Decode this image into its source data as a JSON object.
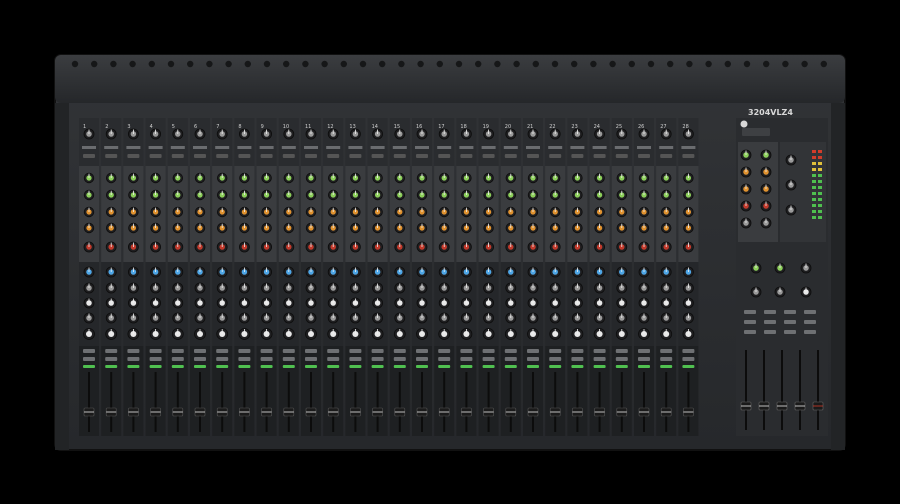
{
  "mixer": {
    "model_label": "3204VLZ4",
    "channels": [
      "1",
      "2",
      "3",
      "4",
      "5",
      "6",
      "7",
      "8",
      "9",
      "10",
      "11",
      "12",
      "13",
      "14",
      "15",
      "16",
      "17",
      "18",
      "19",
      "20",
      "21",
      "22",
      "23",
      "24",
      "25",
      "26",
      "27",
      "28"
    ],
    "colors": {
      "background": "#000000",
      "chassis": "#2c2e30",
      "chassis_dark": "#1b1c1e",
      "panel": "#3a3c3f",
      "knob": "#1f1f21",
      "knob_cap_gray": "#9a9a9a",
      "knob_cap_green": "#8ccf5a",
      "knob_cap_orange": "#e0922f",
      "knob_cap_red": "#c23a2c",
      "knob_cap_blue": "#4ea6e6",
      "knob_cap_white": "#e8e8e8"
    }
  }
}
